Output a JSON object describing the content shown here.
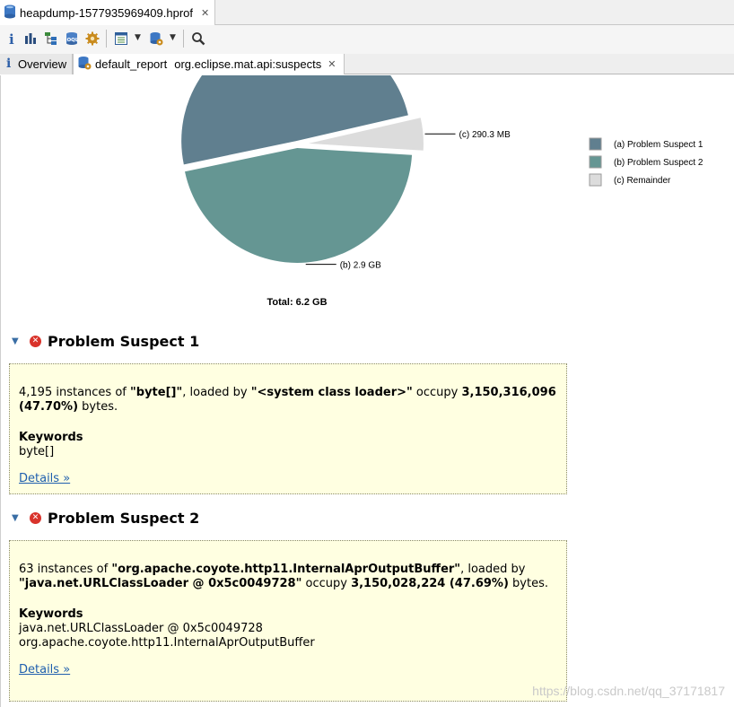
{
  "editor_tab": {
    "label": "heapdump-1577935969409.hprof"
  },
  "toolbar": {
    "icons": [
      "info-icon",
      "histogram-icon",
      "dominator-tree-icon",
      "oql-icon",
      "thread-gear-icon",
      "query-browser-icon",
      "dropdown-arrow",
      "heap-dump-overview-icon",
      "dropdown-arrow",
      "search-icon"
    ]
  },
  "view_tabs": {
    "overview": "Overview",
    "report_name": "default_report",
    "report_id": "org.eclipse.mat.api:suspects"
  },
  "chart_data": {
    "type": "pie",
    "slices": [
      {
        "letter": "(a)",
        "name": "Problem Suspect 1",
        "label": "",
        "value_gb": 3.15,
        "color": "#607f8f"
      },
      {
        "letter": "(b)",
        "name": "Problem Suspect 2",
        "label": "2.9 GB",
        "value_gb": 2.9,
        "color": "#659693"
      },
      {
        "letter": "(c)",
        "name": "Remainder",
        "label": "290.3 MB",
        "value_gb": 0.29,
        "color": "#dcdcdc"
      }
    ],
    "total_label": "Total: 6.2 GB",
    "legend_position": "right"
  },
  "suspects": [
    {
      "title": "Problem Suspect 1",
      "desc_count": "4,195",
      "desc_mid": " instances of ",
      "desc_class": "\"byte[]\"",
      "desc_loaded": ", loaded by ",
      "desc_loader": "\"<system class loader>\"",
      "desc_occupy": " occupy ",
      "desc_bytes": "3,150,316,096 (47.70%)",
      "desc_end": " bytes.",
      "keywords_label": "Keywords",
      "keywords": [
        "byte[]"
      ],
      "details": "Details »"
    },
    {
      "title": "Problem Suspect 2",
      "desc_count": "63",
      "desc_mid": " instances of ",
      "desc_class": "\"org.apache.coyote.http11.InternalAprOutputBuffer\"",
      "desc_loaded": ", loaded by ",
      "desc_loader": "\"java.net.URLClassLoader @ 0x5c0049728\"",
      "desc_occupy": " occupy ",
      "desc_bytes": "3,150,028,224 (47.69%)",
      "desc_end": " bytes.",
      "keywords_label": "Keywords",
      "keywords": [
        "java.net.URLClassLoader @ 0x5c0049728",
        "org.apache.coyote.http11.InternalAprOutputBuffer"
      ],
      "details": "Details »"
    }
  ],
  "watermark": "https://blog.csdn.net/qq_37171817"
}
